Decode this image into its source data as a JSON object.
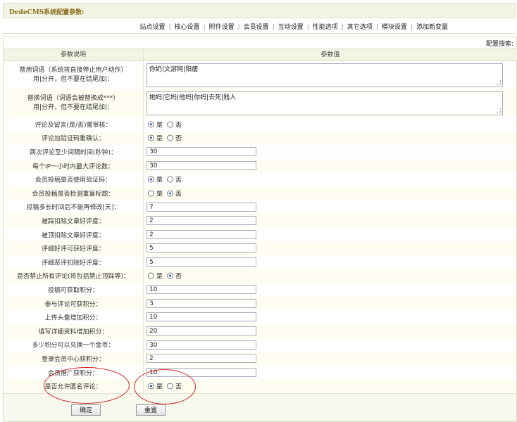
{
  "title": "DedeCMS系统配置参数:",
  "topnav": [
    "站点设置",
    "核心设置",
    "附件设置",
    "会员设置",
    "互动设置",
    "性能选项",
    "其它选项",
    "模块设置",
    "添加新变量"
  ],
  "search_label": "配置搜索:",
  "columns": {
    "label": "参数说明",
    "value": "参数值"
  },
  "rows": [
    {
      "kind": "area",
      "label1": "禁用词语（系统将直接停止用户动作）",
      "label2": "用|分开，但不要在结尾加|：",
      "value": "你奶|文游网|阳痿"
    },
    {
      "kind": "area",
      "label1": "替换词语（词语会被替换成***）",
      "label2": "用|分开，但不要在结尾加|：",
      "value": "她妈|它妈|他妈|你妈|去死|贱人"
    },
    {
      "kind": "radio",
      "label": "评论及留言(是/否)需审核：",
      "yes": "是",
      "no": "否",
      "selected": "yes"
    },
    {
      "kind": "radio",
      "label": "评论加验证码重确认：",
      "yes": "是",
      "no": "否",
      "selected": "yes"
    },
    {
      "kind": "text",
      "label": "两次评论至少间隔时间(秒钟)：",
      "value": "30"
    },
    {
      "kind": "text",
      "label": "每个IP一小时内最大评论数：",
      "value": "30"
    },
    {
      "kind": "radio",
      "label": "会员投稿是否使用验证码：",
      "yes": "是",
      "no": "否",
      "selected": "yes"
    },
    {
      "kind": "radio",
      "label": "会员投稿是否检测重复标题：",
      "yes": "是",
      "no": "否",
      "selected": "no"
    },
    {
      "kind": "text",
      "label": "投稿多长时间后不能再修改[天]：",
      "value": "7"
    },
    {
      "kind": "text",
      "label": "被踩扣除文章好评度：",
      "value": "2"
    },
    {
      "kind": "text",
      "label": "被顶扣除文章好评度：",
      "value": "2"
    },
    {
      "kind": "text",
      "label": "评细好评可获好评度：",
      "value": "5"
    },
    {
      "kind": "text",
      "label": "评细恶评扣除好评度：",
      "value": "5"
    },
    {
      "kind": "radio",
      "label": "是否禁止所有评论(将包括禁止顶踩等)：",
      "yes": "是",
      "no": "否",
      "selected": "no"
    },
    {
      "kind": "text",
      "label": "投稿可获取积分：",
      "value": "10"
    },
    {
      "kind": "text",
      "label": "参与评论可获积分：",
      "value": "3"
    },
    {
      "kind": "text",
      "label": "上传头像增加积分：",
      "value": "10"
    },
    {
      "kind": "text",
      "label": "填写详细资料增加积分：",
      "value": "20"
    },
    {
      "kind": "text",
      "label": "多少积分可以兑换一个金币：",
      "value": "30"
    },
    {
      "kind": "text",
      "label": "登录会员中心获积分：",
      "value": "2"
    },
    {
      "kind": "text",
      "label": "会员推广获积分：",
      "value": "10"
    },
    {
      "kind": "radio",
      "label": "是否允许匿名评论：",
      "yes": "是",
      "no": "否",
      "selected": "yes"
    }
  ],
  "buttons": {
    "ok": "确定",
    "reset": "重置"
  },
  "annotation_color": "#d22222"
}
